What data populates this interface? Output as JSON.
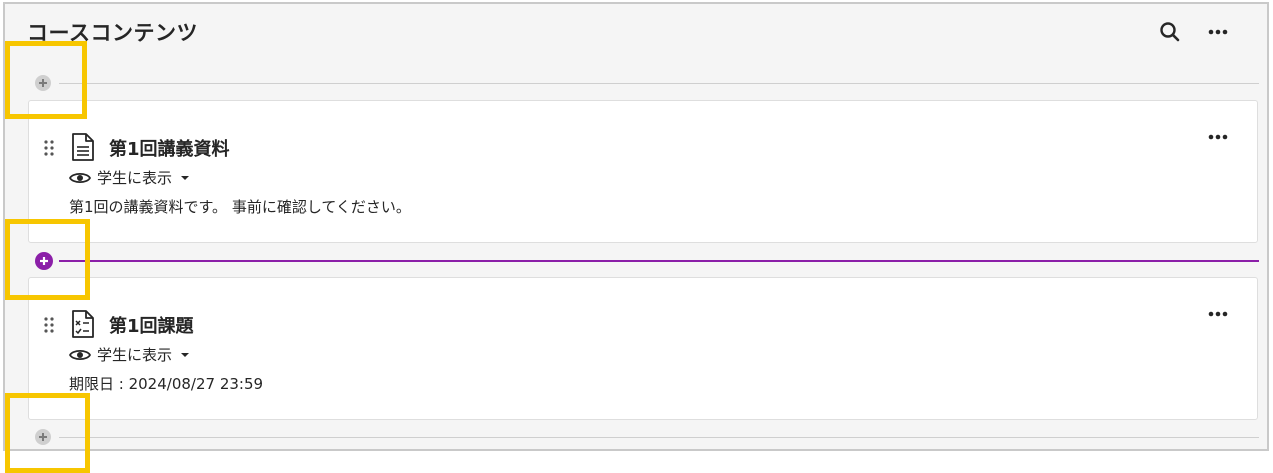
{
  "header": {
    "title": "コースコンテンツ",
    "search_icon": "search-icon",
    "more_icon": "more-horizontal-icon"
  },
  "items": [
    {
      "title": "第1回講義資料",
      "type_icon": "document-icon",
      "visibility": "学生に表示",
      "description": "第1回の講義資料です。 事前に確認してください。"
    },
    {
      "title": "第1回課題",
      "type_icon": "assignment-icon",
      "visibility": "学生に表示",
      "description": "期限日 : 2024/08/27 23:59"
    }
  ],
  "colors": {
    "accent_purple": "#8b1fa8",
    "highlight_yellow": "#f7c600",
    "frame_bg": "#f5f5f5"
  }
}
